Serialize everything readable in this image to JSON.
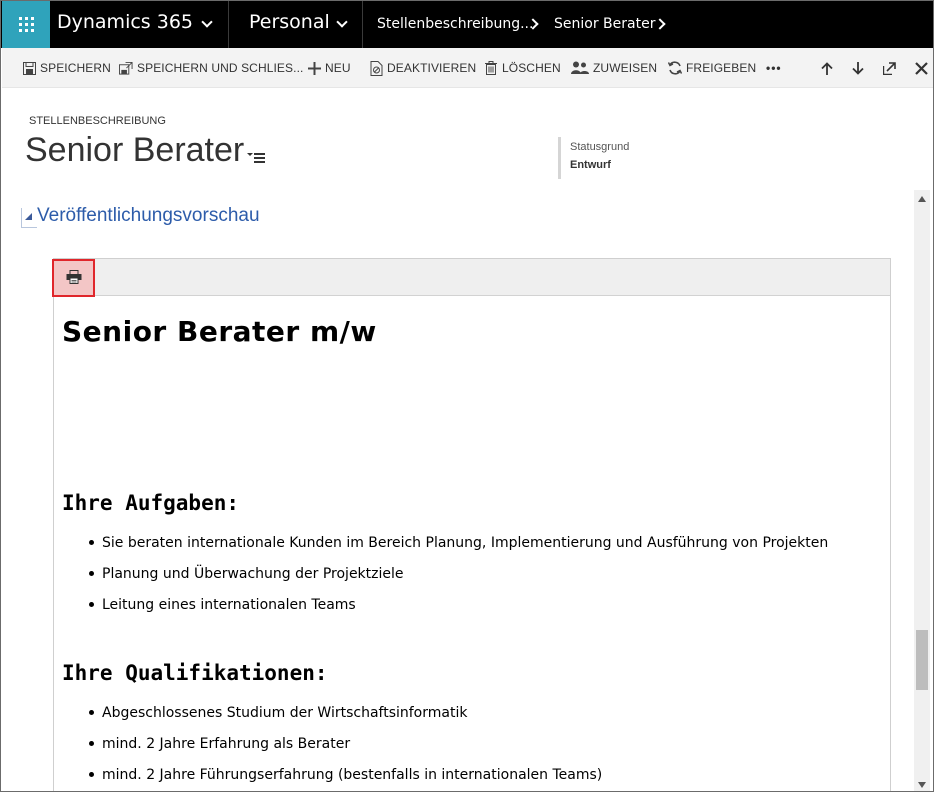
{
  "topnav": {
    "app_name": "Dynamics 365",
    "area": "Personal",
    "breadcrumbs": [
      "Stellenbeschreibung...",
      "Senior Berater"
    ]
  },
  "commands": {
    "save": "SPEICHERN",
    "save_close": "SPEICHERN UND SCHLIES...",
    "new": "NEU",
    "deactivate": "DEAKTIVIEREN",
    "delete": "LÖSCHEN",
    "assign": "ZUWEISEN",
    "share": "FREIGEBEN",
    "more": "•••"
  },
  "header": {
    "entity": "STELLENBESCHREIBUNG",
    "title": "Senior Berater",
    "status_label": "Statusgrund",
    "status_value": "Entwurf"
  },
  "section": {
    "title": "Veröffentlichungsvorschau"
  },
  "document": {
    "title": "Senior Berater m/w",
    "tasks_heading": "Ihre Aufgaben:",
    "tasks": [
      "Sie beraten internationale Kunden im Bereich Planung, Implementierung und Ausführung von Projekten",
      "Planung und Überwachung der Projektziele",
      "Leitung eines internationalen Teams"
    ],
    "qual_heading": "Ihre Qualifikationen:",
    "qualifications": [
      "Abgeschlossenes Studium der Wirtschaftsinformatik",
      "mind. 2 Jahre Erfahrung als Berater",
      "mind. 2 Jahre Führungserfahrung (bestenfalls in internationalen Teams)"
    ]
  },
  "colors": {
    "accent": "#2fa3bb",
    "nav_bg": "#000000",
    "link": "#2d5caa",
    "highlight_border": "#e0262b"
  }
}
